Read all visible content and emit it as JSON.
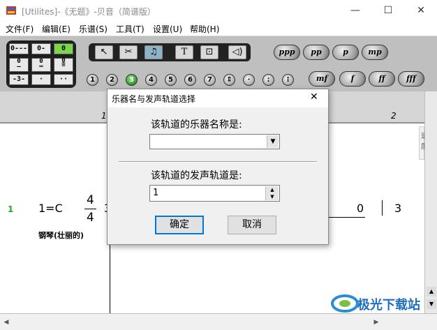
{
  "window": {
    "title": "[Utilites]-《无题》-贝音（简谱版）",
    "minimize": "—",
    "maximize": "☐",
    "close": "✕"
  },
  "menu": [
    "文件(F)",
    "编辑(E)",
    "乐谱(S)",
    "工具(T)",
    "设置(U)",
    "帮助(H)"
  ],
  "toolbar": {
    "durations": [
      [
        "0---",
        "0-",
        "0"
      ],
      [
        "0",
        "0",
        "0"
      ],
      [
        "-3-",
        "·",
        "··"
      ]
    ],
    "duration_active": "0",
    "tools": [
      "↖",
      "✂",
      "♫",
      "T",
      "⊡",
      "◁)"
    ],
    "active_tool_index": 2,
    "dynamics_top": [
      "ppp",
      "pp",
      "p",
      "mp"
    ],
    "dynamics_bottom": [
      "mf",
      "f",
      "ff",
      "fff"
    ],
    "numbers": [
      "1",
      "2",
      "3",
      "4",
      "5",
      "6",
      "7"
    ],
    "active_number": "3",
    "extra_symbols": [
      "⇕",
      "·",
      ":",
      "⁝"
    ]
  },
  "score": {
    "ruler_marks": [
      "1",
      "2"
    ],
    "track_number": "1",
    "key": "1=C",
    "time_sig_top": "4",
    "time_sig_bottom": "4",
    "first_note": "3",
    "notes_right": [
      "0",
      "3"
    ],
    "instrument": "钢琴(壮丽的)",
    "side_label": "速度"
  },
  "dialog": {
    "title": "乐器名与发声轨道选择",
    "close": "✕",
    "instrument_label": "该轨道的乐器名称是:",
    "instrument_value": "",
    "track_label": "该轨道的发声轨道是:",
    "track_value": "1",
    "ok": "确定",
    "cancel": "取消"
  },
  "scrollbars": {
    "left_arrow": "◀",
    "right_arrow": "▶",
    "up_arrow": "▲",
    "down_arrow": "▼"
  },
  "watermark": "极光下载站"
}
